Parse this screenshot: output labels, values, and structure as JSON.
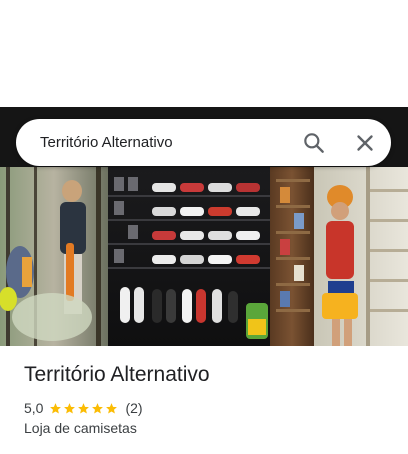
{
  "search": {
    "query": "Território Alternativo"
  },
  "place": {
    "name": "Território Alternativo",
    "rating": "5,0",
    "stars": 5,
    "review_count": "(2)",
    "category": "Loja de camisetas"
  },
  "colors": {
    "star": "#fbbc04",
    "text_primary": "#202124",
    "text_secondary": "#3c4043"
  },
  "icons": {
    "search": "search-icon",
    "close": "close-icon",
    "star": "star-icon"
  }
}
